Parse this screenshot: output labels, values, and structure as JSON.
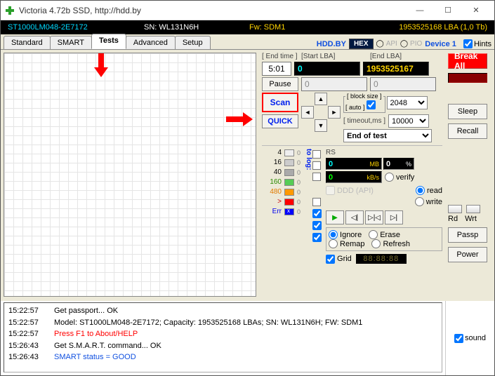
{
  "window": {
    "title": "Victoria 4.72b SSD, http://hdd.by"
  },
  "status": {
    "model": "ST1000LM048-2E7172",
    "sn": "SN: WL131N6H",
    "fw": "Fw: SDM1",
    "lba": "1953525168 LBA (1,0 Tb)"
  },
  "tabs": {
    "items": [
      "Standard",
      "SMART",
      "Tests",
      "Advanced",
      "Setup"
    ],
    "active": 2,
    "hdd": "HDD.BY",
    "hex": "HEX",
    "api": "API",
    "pio": "PIO",
    "device": "Device 1",
    "hints": "Hints"
  },
  "top": {
    "end_time_label": "[ End time ]",
    "start_lba_label": "[Start LBA]",
    "end_lba_label": "[End LBA]",
    "end_time": "5:01",
    "start_lba": "0",
    "end_lba": "1953525167",
    "cur_a": "0",
    "cur_b": "0",
    "pause": "Pause",
    "scan": "Scan",
    "quick": "QUICK",
    "block_label": "[ block size ]",
    "auto_label": "[ auto ]",
    "block": "2048",
    "timeout_label": "[ timeout,ms ]",
    "timeout": "10000",
    "end_sel": "End of test"
  },
  "break_all": "Break All",
  "rs_label": "RS",
  "mb_val": "0",
  "mb_unit": "MB",
  "pct_val": "0",
  "pct_unit": "%",
  "kbs_val": "0",
  "kbs_unit": "kB/s",
  "ddd": "DDD (API)",
  "modes": {
    "verify": "verify",
    "read": "read",
    "write": "write"
  },
  "actions": {
    "ignore": "Ignore",
    "erase": "Erase",
    "remap": "Remap",
    "refresh": "Refresh"
  },
  "grid_chk": "Grid",
  "timer": "88:88:88",
  "to_log": "to log:",
  "timing": {
    "t4": "4",
    "t16": "16",
    "t40": "40",
    "t160": "160",
    "t480": "480",
    "tgt": ">",
    "tgt_val": "0",
    "err": "Err",
    "err_val": "0"
  },
  "side": {
    "sleep": "Sleep",
    "recall": "Recall",
    "rd": "Rd",
    "wrt": "Wrt",
    "passp": "Passp",
    "power": "Power"
  },
  "log": [
    {
      "time": "15:22:57",
      "msg": "Get passport... OK",
      "cls": ""
    },
    {
      "time": "15:22:57",
      "msg": "Model: ST1000LM048-2E7172; Capacity: 1953525168 LBAs; SN: WL131N6H; FW: SDM1",
      "cls": ""
    },
    {
      "time": "15:22:57",
      "msg": "Press F1 to About/HELP",
      "cls": "red"
    },
    {
      "time": "15:26:43",
      "msg": "Get S.M.A.R.T. command... OK",
      "cls": ""
    },
    {
      "time": "15:26:43",
      "msg": "SMART status = GOOD",
      "cls": "blue"
    }
  ],
  "sound": "sound"
}
